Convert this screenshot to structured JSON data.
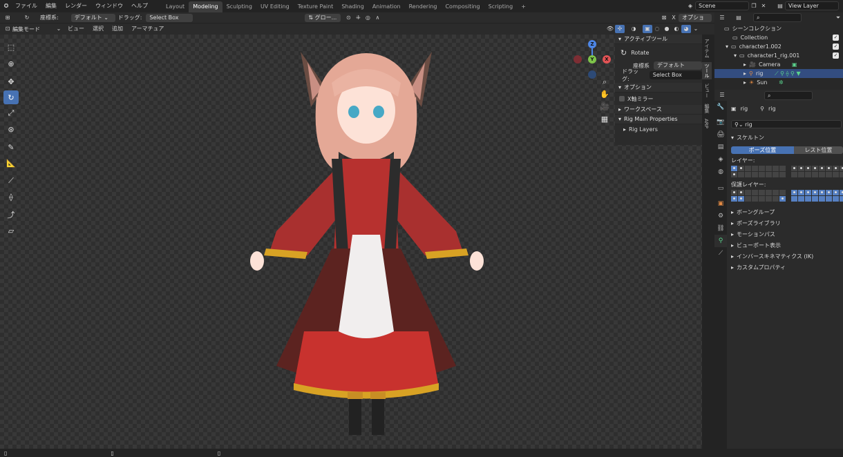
{
  "topbar": {
    "menus": [
      "ファイル",
      "編集",
      "レンダー",
      "ウィンドウ",
      "ヘルプ"
    ],
    "workspaces": [
      "Layout",
      "Modeling",
      "Sculpting",
      "UV Editing",
      "Texture Paint",
      "Shading",
      "Animation",
      "Rendering",
      "Compositing",
      "Scripting"
    ],
    "active_workspace": "Modeling",
    "add_tab": "+",
    "scene": "Scene",
    "view_layer": "View Layer"
  },
  "header1": {
    "orientation_label": "座標系:",
    "orientation_value": "デフォルト",
    "drag_label": "ドラッグ:",
    "drag_value": "Select Box",
    "transform_global": "グロー...",
    "options_label": "オプション"
  },
  "header2": {
    "mode": "編集モード",
    "menus": [
      "ビュー",
      "選択",
      "追加",
      "アーマチュア"
    ]
  },
  "gizmo": {
    "z": "Z",
    "y": "Y",
    "x": "X"
  },
  "npanel": {
    "active_tool_title": "アクティブツール",
    "tool_name": "Rotate",
    "orientation_label": "座標系",
    "orientation_value": "デフォルト",
    "drag_label": "ドラッグ:",
    "drag_value": "Select Box",
    "options_title": "オプション",
    "x_mirror": "X軸ミラー",
    "workspace_title": "ワークスペース",
    "rig_main_title": "Rig Main Properties",
    "rig_layers": "Rig Layers"
  },
  "sidetabs": [
    "アイテム",
    "ツール",
    "ビュー",
    "編集",
    "ARP"
  ],
  "outliner": {
    "search_placeholder": "",
    "rows": [
      {
        "label": "シーンコレクション",
        "indent": 0
      },
      {
        "label": "Collection",
        "indent": 1
      },
      {
        "label": "character1.002",
        "indent": 1
      },
      {
        "label": "character1_rig.001",
        "indent": 2
      },
      {
        "label": "Camera",
        "indent": 3
      },
      {
        "label": "rig",
        "indent": 3
      },
      {
        "label": "Sun",
        "indent": 3
      }
    ]
  },
  "properties": {
    "breadcrumb_obj": "rig",
    "breadcrumb_data": "rig",
    "data_name": "rig",
    "skeleton_title": "スケルトン",
    "pose_position": "ポーズ位置",
    "rest_position": "レスト位置",
    "layers_label": "レイヤー:",
    "protected_layers_label": "保護レイヤー:",
    "sections": [
      "ボーングループ",
      "ポーズライブラリ",
      "モーションパス",
      "ビューポート表示",
      "インバースキネマティクス (IK)",
      "カスタムプロパティ"
    ]
  },
  "colors": {
    "accent": "#4772b3",
    "selected_row": "#334d80",
    "bone_green": "#5bd38d"
  }
}
